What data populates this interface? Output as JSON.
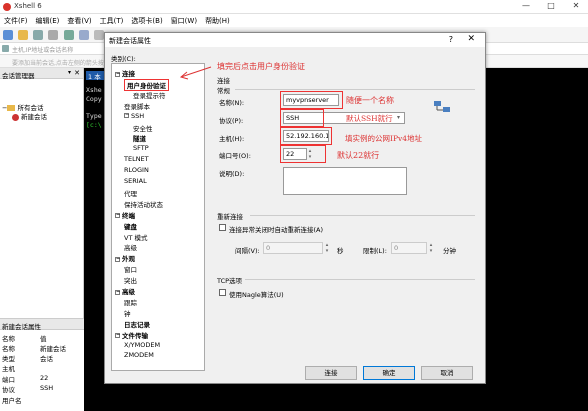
{
  "app": {
    "title": "Xshell 6",
    "menu": [
      "文件(F)",
      "编辑(E)",
      "查看(V)",
      "工具(T)",
      "选项卡(B)",
      "窗口(W)",
      "帮助(H)"
    ],
    "address_hint": "主机,IP地址或会话名称",
    "hint_text": "要添加当前会话,点击左侧的箭头按钮。",
    "window_controls": [
      "—",
      "□",
      "✕"
    ]
  },
  "session_manager": {
    "title": "会话管理器",
    "pin": "▾ ✕",
    "close": "✕",
    "tree": [
      {
        "label": "所有会话",
        "level": 0
      },
      {
        "label": "新建会话",
        "level": 1
      }
    ]
  },
  "session_props": {
    "title": "新建会话属性",
    "header": {
      "k": "名称",
      "v": "值"
    },
    "rows": [
      {
        "k": "名称",
        "v": "新建会话"
      },
      {
        "k": "类型",
        "v": "会话"
      },
      {
        "k": "主机",
        "v": ""
      },
      {
        "k": "端口",
        "v": "22"
      },
      {
        "k": "协议",
        "v": "SSH"
      },
      {
        "k": "用户名",
        "v": ""
      }
    ]
  },
  "terminal": {
    "tab": "1 本",
    "lines": [
      "Xshe",
      "Copy",
      "",
      "Type",
      "[c:\\"
    ]
  },
  "dialog": {
    "title": "新建会话属性",
    "help": "?",
    "close": "✕",
    "category_label": "类别(C):",
    "tree": [
      {
        "label": "连接",
        "indent": 0,
        "bold": true,
        "toggle": "−"
      },
      {
        "label": "用户身份验证",
        "indent": 1,
        "bold": true,
        "selected": true
      },
      {
        "label": "登录提示符",
        "indent": 2
      },
      {
        "label": "登录脚本",
        "indent": 1
      },
      {
        "label": "SSH",
        "indent": 1,
        "toggle": "−"
      },
      {
        "label": "安全性",
        "indent": 2
      },
      {
        "label": "隧道",
        "indent": 2,
        "bold": true
      },
      {
        "label": "SFTP",
        "indent": 2
      },
      {
        "label": "TELNET",
        "indent": 1
      },
      {
        "label": "RLOGIN",
        "indent": 1
      },
      {
        "label": "SERIAL",
        "indent": 1
      },
      {
        "label": "代理",
        "indent": 1
      },
      {
        "label": "保持活动状态",
        "indent": 1
      },
      {
        "label": "终端",
        "indent": 0,
        "bold": true,
        "toggle": "−"
      },
      {
        "label": "键盘",
        "indent": 1,
        "bold": true
      },
      {
        "label": "VT 模式",
        "indent": 1
      },
      {
        "label": "高级",
        "indent": 1
      },
      {
        "label": "外观",
        "indent": 0,
        "bold": true,
        "toggle": "−"
      },
      {
        "label": "窗口",
        "indent": 1
      },
      {
        "label": "突出",
        "indent": 1
      },
      {
        "label": "高级",
        "indent": 0,
        "bold": true,
        "toggle": "−"
      },
      {
        "label": "跟踪",
        "indent": 1
      },
      {
        "label": "钟",
        "indent": 1
      },
      {
        "label": "日志记录",
        "indent": 1,
        "bold": true
      },
      {
        "label": "文件传输",
        "indent": 0,
        "bold": true,
        "toggle": "−"
      },
      {
        "label": "X/YMODEM",
        "indent": 1
      },
      {
        "label": "ZMODEM",
        "indent": 1
      }
    ],
    "group_connection": "连接",
    "group_general": "常规",
    "name_label": "名称(N):",
    "name_value": "myvpnserver",
    "protocol_label": "协议(P):",
    "protocol_value": "SSH",
    "host_label": "主机(H):",
    "host_value": "52.192.160.1",
    "port_label": "端口号(O):",
    "port_value": "22",
    "desc_label": "说明(D):",
    "desc_value": "",
    "group_reconnect": "重新连接",
    "reconnect_checkbox": "连接异常关闭时自动重新连接(A)",
    "interval_label": "间隔(V):",
    "interval_value": "0",
    "interval_unit": "秒",
    "limit_label": "限制(L):",
    "limit_value": "0",
    "limit_unit": "分钟",
    "group_tcp": "TCP选项",
    "nagle_checkbox": "使用Nagle算法(U)",
    "btn_connect": "连接",
    "btn_ok": "确定",
    "btn_cancel": "取消"
  },
  "annotations": {
    "auth": "填完后点击用户身份验证",
    "name": "随便一个名称",
    "protocol": "默认SSH就行",
    "host": "填实例的公网IPv4地址",
    "port": "默认22就行"
  },
  "colors": {
    "annotation_red": "#dd3333",
    "terminal_bg": "#000000",
    "accent_blue": "#0078d7"
  }
}
